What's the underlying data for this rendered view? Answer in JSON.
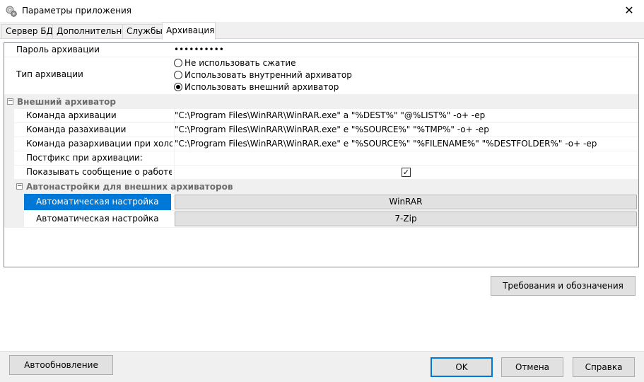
{
  "window": {
    "title": "Параметры приложения",
    "close_glyph": "✕"
  },
  "tabs": [
    {
      "label": "Сервер БД"
    },
    {
      "label": "Дополнительно"
    },
    {
      "label": "Службы"
    },
    {
      "label": "Архивация"
    }
  ],
  "grid": {
    "password": {
      "label": "Пароль архивации",
      "value": "••••••••••"
    },
    "archive_type": {
      "label": "Тип архивации",
      "options": [
        "Не использовать сжатие",
        "Использовать внутренний архиватор",
        "Использовать внешний архиватор"
      ],
      "selected": 2
    },
    "external": {
      "label": "Внешний архиватор",
      "rows": [
        {
          "label": "Команда архивации",
          "value": "\"C:\\Program Files\\WinRAR\\WinRAR.exe\" a \"%DEST%\" \"@%LIST%\" -o+ -ep"
        },
        {
          "label": "Команда разахивации",
          "value": "\"C:\\Program Files\\WinRAR\\WinRAR.exe\" e \"%SOURCE%\" \"%TMP%\" -o+ -ep"
        },
        {
          "label": "Команда разархивации при холодно",
          "value": "\"C:\\Program Files\\WinRAR\\WinRAR.exe\" e \"%SOURCE%\" \"%FILENAME%\" \"%DESTFOLDER%\" -o+ -ep"
        },
        {
          "label": "Постфикс при архивации:",
          "value": ""
        },
        {
          "label": "Показывать сообщение о работе вне",
          "checked": true
        }
      ]
    },
    "autosettings": {
      "label": "Автонастройки для внешних архиваторов",
      "rows": [
        {
          "label": "Автоматическая настройка",
          "button": "WinRAR"
        },
        {
          "label": "Автоматическая настройка",
          "button": "7-Zip"
        }
      ]
    }
  },
  "buttons": {
    "requirements": "Требования и обозначения",
    "autoupdate": "Автообновление",
    "ok": "OK",
    "cancel": "Отмена",
    "help": "Справка"
  },
  "icons": {
    "app": "gear-disc-icon",
    "expander": "minus-box-icon"
  },
  "colors": {
    "selection": "#0078d7",
    "category_bg": "#f0f0f0",
    "default_button_border": "#0078d7"
  }
}
